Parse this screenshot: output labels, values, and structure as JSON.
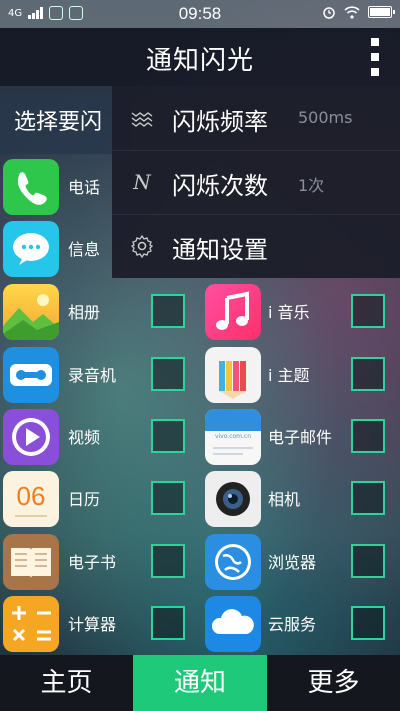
{
  "status_bar": {
    "network": "4G",
    "time": "09:58"
  },
  "header": {
    "title": "通知闪光"
  },
  "select_header": "选择要闪",
  "dropdown": {
    "items": [
      {
        "label": "闪烁频率",
        "value": "500ms",
        "icon": "waves-icon"
      },
      {
        "label": "闪烁次数",
        "value": "1次",
        "icon": "n-icon"
      },
      {
        "label": "通知设置",
        "value": "",
        "icon": "gear-icon"
      }
    ]
  },
  "apps_left": [
    {
      "label": "电话",
      "icon": "phone-icon"
    },
    {
      "label": "信息",
      "icon": "message-icon"
    },
    {
      "label": "相册",
      "icon": "gallery-icon"
    },
    {
      "label": "录音机",
      "icon": "recorder-icon"
    },
    {
      "label": "视频",
      "icon": "video-icon"
    },
    {
      "label": "日历",
      "icon": "calendar-icon",
      "icon_text": "06"
    },
    {
      "label": "电子书",
      "icon": "ebook-icon"
    },
    {
      "label": "计算器",
      "icon": "calculator-icon"
    }
  ],
  "apps_right": [
    {
      "label": "i 音乐",
      "icon": "music-icon"
    },
    {
      "label": "i 主题",
      "icon": "theme-icon"
    },
    {
      "label": "电子邮件",
      "icon": "email-icon",
      "icon_text": "vivo.com.cn"
    },
    {
      "label": "相机",
      "icon": "camera-icon"
    },
    {
      "label": "浏览器",
      "icon": "browser-icon"
    },
    {
      "label": "云服务",
      "icon": "cloud-icon"
    }
  ],
  "bottom_nav": {
    "tabs": [
      {
        "label": "主页"
      },
      {
        "label": "通知"
      },
      {
        "label": "更多"
      }
    ]
  },
  "colors": {
    "accent": "#1fc97a",
    "checkbox_border": "#2ed39a"
  }
}
